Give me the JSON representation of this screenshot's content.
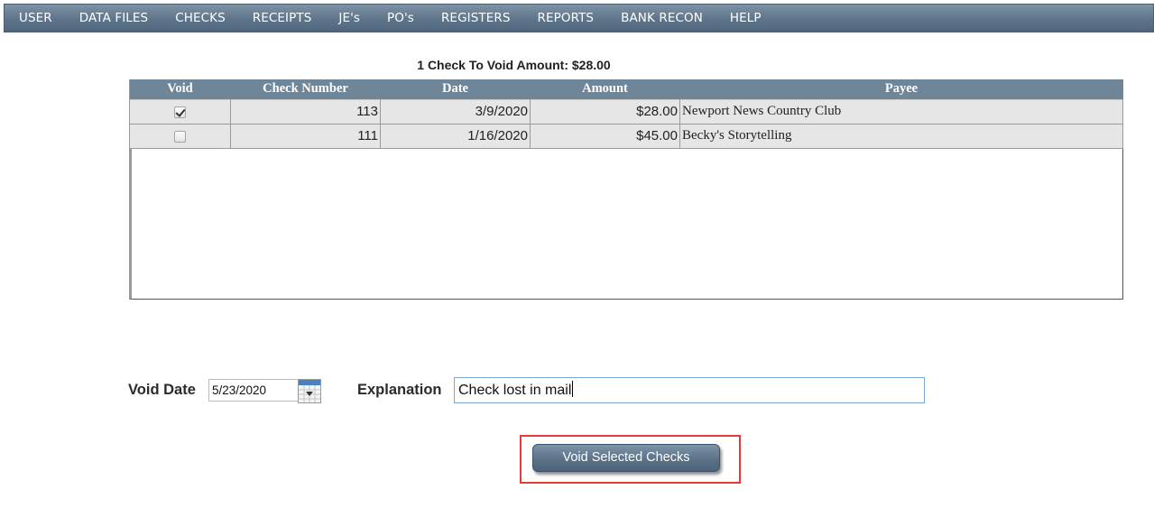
{
  "nav": {
    "items": [
      "USER",
      "DATA FILES",
      "CHECKS",
      "RECEIPTS",
      "JE's",
      "PO's",
      "REGISTERS",
      "REPORTS",
      "BANK RECON",
      "HELP"
    ]
  },
  "summary": "1 Check To Void Amount: $28.00",
  "table": {
    "headers": [
      "Void",
      "Check Number",
      "Date",
      "Amount",
      "Payee"
    ],
    "rows": [
      {
        "void": true,
        "check_number": "113",
        "date": "3/9/2020",
        "amount": "$28.00",
        "payee": "Newport News Country Club"
      },
      {
        "void": false,
        "check_number": "111",
        "date": "1/16/2020",
        "amount": "$45.00",
        "payee": "Becky's Storytelling"
      }
    ]
  },
  "form": {
    "void_date_label": "Void Date",
    "void_date_value": "5/23/2020",
    "explanation_label": "Explanation",
    "explanation_value": "Check lost in mail",
    "submit_label": "Void Selected Checks"
  },
  "colors": {
    "nav_bg": "#5d748a",
    "header_bg": "#6f8699",
    "row_bg": "#e6e6e6",
    "highlight": "#e23b3b",
    "input_focus_border": "#7aa8d6"
  },
  "icons": {
    "calendar": "calendar-icon",
    "checkbox_checked": "checkbox-checked",
    "checkbox_unchecked": "checkbox-unchecked"
  }
}
